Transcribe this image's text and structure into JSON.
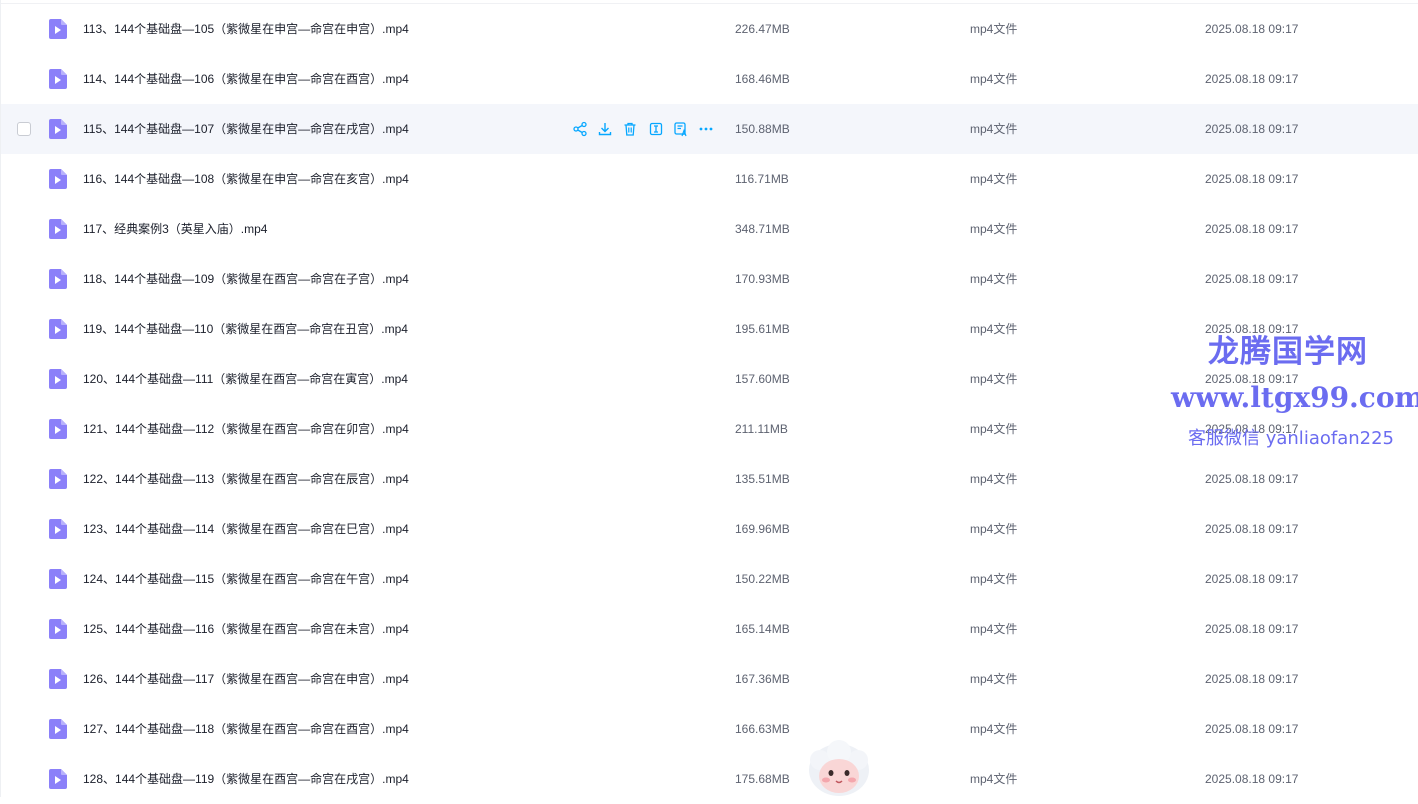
{
  "files": [
    {
      "name": "113、144个基础盘—105（紫微星在申宫—命宫在申宫）.mp4",
      "size": "226.47MB",
      "type": "mp4文件",
      "date": "2025.08.18 09:17"
    },
    {
      "name": "114、144个基础盘—106（紫微星在申宫—命宫在酉宫）.mp4",
      "size": "168.46MB",
      "type": "mp4文件",
      "date": "2025.08.18 09:17"
    },
    {
      "name": "115、144个基础盘—107（紫微星在申宫—命宫在戌宫）.mp4",
      "size": "150.88MB",
      "type": "mp4文件",
      "date": "2025.08.18 09:17"
    },
    {
      "name": "116、144个基础盘—108（紫微星在申宫—命宫在亥宫）.mp4",
      "size": "116.71MB",
      "type": "mp4文件",
      "date": "2025.08.18 09:17"
    },
    {
      "name": "117、经典案例3（英星入庙）.mp4",
      "size": "348.71MB",
      "type": "mp4文件",
      "date": "2025.08.18 09:17"
    },
    {
      "name": "118、144个基础盘—109（紫微星在酉宫—命宫在子宫）.mp4",
      "size": "170.93MB",
      "type": "mp4文件",
      "date": "2025.08.18 09:17"
    },
    {
      "name": "119、144个基础盘—110（紫微星在酉宫—命宫在丑宫）.mp4",
      "size": "195.61MB",
      "type": "mp4文件",
      "date": "2025.08.18 09:17"
    },
    {
      "name": "120、144个基础盘—111（紫微星在酉宫—命宫在寅宫）.mp4",
      "size": "157.60MB",
      "type": "mp4文件",
      "date": "2025.08.18 09:17"
    },
    {
      "name": "121、144个基础盘—112（紫微星在酉宫—命宫在卯宫）.mp4",
      "size": "211.11MB",
      "type": "mp4文件",
      "date": "2025.08.18 09:17"
    },
    {
      "name": "122、144个基础盘—113（紫微星在酉宫—命宫在辰宫）.mp4",
      "size": "135.51MB",
      "type": "mp4文件",
      "date": "2025.08.18 09:17"
    },
    {
      "name": "123、144个基础盘—114（紫微星在酉宫—命宫在巳宫）.mp4",
      "size": "169.96MB",
      "type": "mp4文件",
      "date": "2025.08.18 09:17"
    },
    {
      "name": "124、144个基础盘—115（紫微星在酉宫—命宫在午宫）.mp4",
      "size": "150.22MB",
      "type": "mp4文件",
      "date": "2025.08.18 09:17"
    },
    {
      "name": "125、144个基础盘—116（紫微星在酉宫—命宫在未宫）.mp4",
      "size": "165.14MB",
      "type": "mp4文件",
      "date": "2025.08.18 09:17"
    },
    {
      "name": "126、144个基础盘—117（紫微星在酉宫—命宫在申宫）.mp4",
      "size": "167.36MB",
      "type": "mp4文件",
      "date": "2025.08.18 09:17"
    },
    {
      "name": "127、144个基础盘—118（紫微星在酉宫—命宫在酉宫）.mp4",
      "size": "166.63MB",
      "type": "mp4文件",
      "date": "2025.08.18 09:17"
    },
    {
      "name": "128、144个基础盘—119（紫微星在酉宫—命宫在戌宫）.mp4",
      "size": "175.68MB",
      "type": "mp4文件",
      "date": "2025.08.18 09:17"
    }
  ],
  "hovered_row": 2,
  "row_actions": [
    "share-icon",
    "download-icon",
    "delete-icon",
    "ai-summary-icon",
    "ai-translate-icon",
    "more-icon"
  ],
  "watermark": {
    "title": "龙腾国学网",
    "url": "www.ltgx99.com",
    "contact": "客服微信 yanliaofan225"
  },
  "colors": {
    "accent": "#06a7ff",
    "file_icon": "#8b80f9",
    "hover_bg": "#f4f6fb",
    "watermark": "#6b6cf0"
  }
}
